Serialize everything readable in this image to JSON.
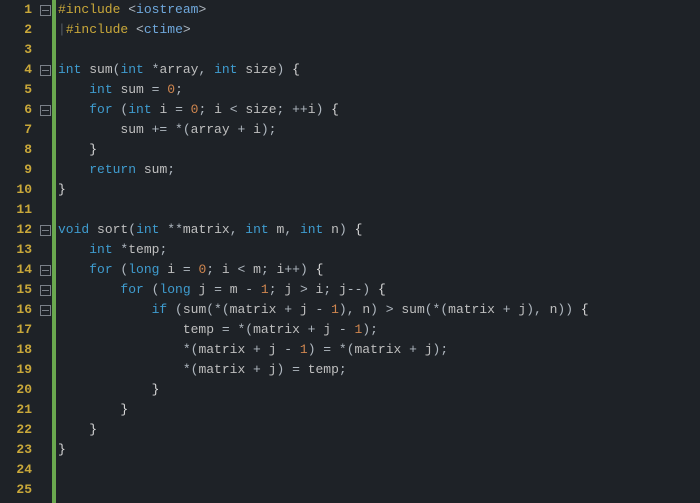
{
  "language": "cpp",
  "tab_size": 4,
  "lines": [
    {
      "n": 1,
      "fold": true,
      "tokens": [
        [
          "pp",
          "#include"
        ],
        [
          "op",
          " "
        ],
        [
          "op",
          "<"
        ],
        [
          "hdr",
          "iostream"
        ],
        [
          "op",
          ">"
        ]
      ]
    },
    {
      "n": 2,
      "fold": false,
      "bar_indent": 1,
      "tokens": [
        [
          "pp",
          "#include"
        ],
        [
          "op",
          " "
        ],
        [
          "op",
          "<"
        ],
        [
          "hdr",
          "ctime"
        ],
        [
          "op",
          ">"
        ]
      ]
    },
    {
      "n": 3,
      "fold": false,
      "tokens": []
    },
    {
      "n": 4,
      "fold": true,
      "tokens": [
        [
          "kw",
          "int"
        ],
        [
          "op",
          " "
        ],
        [
          "fn",
          "sum"
        ],
        [
          "op",
          "("
        ],
        [
          "kw",
          "int"
        ],
        [
          "op",
          " *"
        ],
        [
          "id",
          "array"
        ],
        [
          "op",
          ", "
        ],
        [
          "kw",
          "int"
        ],
        [
          "op",
          " "
        ],
        [
          "id",
          "size"
        ],
        [
          "op",
          ") "
        ],
        [
          "brace",
          "{"
        ]
      ]
    },
    {
      "n": 5,
      "fold": false,
      "tokens": [
        [
          "op",
          "    "
        ],
        [
          "kw",
          "int"
        ],
        [
          "op",
          " "
        ],
        [
          "id",
          "sum"
        ],
        [
          "op",
          " = "
        ],
        [
          "num",
          "0"
        ],
        [
          "op",
          ";"
        ]
      ]
    },
    {
      "n": 6,
      "fold": true,
      "tokens": [
        [
          "op",
          "    "
        ],
        [
          "ctl",
          "for"
        ],
        [
          "op",
          " ("
        ],
        [
          "kw",
          "int"
        ],
        [
          "op",
          " "
        ],
        [
          "id",
          "i"
        ],
        [
          "op",
          " = "
        ],
        [
          "num",
          "0"
        ],
        [
          "op",
          "; "
        ],
        [
          "id",
          "i"
        ],
        [
          "op",
          " < "
        ],
        [
          "id",
          "size"
        ],
        [
          "op",
          "; ++"
        ],
        [
          "id",
          "i"
        ],
        [
          "op",
          ") "
        ],
        [
          "brace",
          "{"
        ]
      ]
    },
    {
      "n": 7,
      "fold": false,
      "tokens": [
        [
          "op",
          "        "
        ],
        [
          "id",
          "sum"
        ],
        [
          "op",
          " += *("
        ],
        [
          "id",
          "array"
        ],
        [
          "op",
          " + "
        ],
        [
          "id",
          "i"
        ],
        [
          "op",
          ");"
        ]
      ]
    },
    {
      "n": 8,
      "fold": false,
      "tokens": [
        [
          "op",
          "    "
        ],
        [
          "brace",
          "}"
        ]
      ]
    },
    {
      "n": 9,
      "fold": false,
      "tokens": [
        [
          "op",
          "    "
        ],
        [
          "ctl",
          "return"
        ],
        [
          "op",
          " "
        ],
        [
          "id",
          "sum"
        ],
        [
          "op",
          ";"
        ]
      ]
    },
    {
      "n": 10,
      "fold": false,
      "tokens": [
        [
          "brace",
          "}"
        ]
      ]
    },
    {
      "n": 11,
      "fold": false,
      "tokens": []
    },
    {
      "n": 12,
      "fold": true,
      "tokens": [
        [
          "kw",
          "void"
        ],
        [
          "op",
          " "
        ],
        [
          "fn",
          "sort"
        ],
        [
          "op",
          "("
        ],
        [
          "kw",
          "int"
        ],
        [
          "op",
          " **"
        ],
        [
          "id",
          "matrix"
        ],
        [
          "op",
          ", "
        ],
        [
          "kw",
          "int"
        ],
        [
          "op",
          " "
        ],
        [
          "id",
          "m"
        ],
        [
          "op",
          ", "
        ],
        [
          "kw",
          "int"
        ],
        [
          "op",
          " "
        ],
        [
          "id",
          "n"
        ],
        [
          "op",
          ") "
        ],
        [
          "brace",
          "{"
        ]
      ]
    },
    {
      "n": 13,
      "fold": false,
      "tokens": [
        [
          "op",
          "    "
        ],
        [
          "kw",
          "int"
        ],
        [
          "op",
          " *"
        ],
        [
          "id",
          "temp"
        ],
        [
          "op",
          ";"
        ]
      ]
    },
    {
      "n": 14,
      "fold": true,
      "tokens": [
        [
          "op",
          "    "
        ],
        [
          "ctl",
          "for"
        ],
        [
          "op",
          " ("
        ],
        [
          "kw",
          "long"
        ],
        [
          "op",
          " "
        ],
        [
          "id",
          "i"
        ],
        [
          "op",
          " = "
        ],
        [
          "num",
          "0"
        ],
        [
          "op",
          "; "
        ],
        [
          "id",
          "i"
        ],
        [
          "op",
          " < "
        ],
        [
          "id",
          "m"
        ],
        [
          "op",
          "; "
        ],
        [
          "id",
          "i"
        ],
        [
          "op",
          "++) "
        ],
        [
          "brace",
          "{"
        ]
      ]
    },
    {
      "n": 15,
      "fold": true,
      "tokens": [
        [
          "op",
          "        "
        ],
        [
          "ctl",
          "for"
        ],
        [
          "op",
          " ("
        ],
        [
          "kw",
          "long"
        ],
        [
          "op",
          " "
        ],
        [
          "id",
          "j"
        ],
        [
          "op",
          " = "
        ],
        [
          "id",
          "m"
        ],
        [
          "op",
          " - "
        ],
        [
          "num",
          "1"
        ],
        [
          "op",
          "; "
        ],
        [
          "id",
          "j"
        ],
        [
          "op",
          " > "
        ],
        [
          "id",
          "i"
        ],
        [
          "op",
          "; "
        ],
        [
          "id",
          "j"
        ],
        [
          "op",
          "--) "
        ],
        [
          "brace",
          "{"
        ]
      ]
    },
    {
      "n": 16,
      "fold": true,
      "tokens": [
        [
          "op",
          "            "
        ],
        [
          "ctl",
          "if"
        ],
        [
          "op",
          " ("
        ],
        [
          "fn",
          "sum"
        ],
        [
          "op",
          "(*("
        ],
        [
          "id",
          "matrix"
        ],
        [
          "op",
          " + "
        ],
        [
          "id",
          "j"
        ],
        [
          "op",
          " - "
        ],
        [
          "num",
          "1"
        ],
        [
          "op",
          "), "
        ],
        [
          "id",
          "n"
        ],
        [
          "op",
          ") > "
        ],
        [
          "fn",
          "sum"
        ],
        [
          "op",
          "(*("
        ],
        [
          "id",
          "matrix"
        ],
        [
          "op",
          " + "
        ],
        [
          "id",
          "j"
        ],
        [
          "op",
          "), "
        ],
        [
          "id",
          "n"
        ],
        [
          "op",
          ")) "
        ],
        [
          "brace",
          "{"
        ]
      ]
    },
    {
      "n": 17,
      "fold": false,
      "tokens": [
        [
          "op",
          "                "
        ],
        [
          "id",
          "temp"
        ],
        [
          "op",
          " = *("
        ],
        [
          "id",
          "matrix"
        ],
        [
          "op",
          " + "
        ],
        [
          "id",
          "j"
        ],
        [
          "op",
          " - "
        ],
        [
          "num",
          "1"
        ],
        [
          "op",
          ");"
        ]
      ]
    },
    {
      "n": 18,
      "fold": false,
      "tokens": [
        [
          "op",
          "                *("
        ],
        [
          "id",
          "matrix"
        ],
        [
          "op",
          " + "
        ],
        [
          "id",
          "j"
        ],
        [
          "op",
          " - "
        ],
        [
          "num",
          "1"
        ],
        [
          "op",
          ") = *("
        ],
        [
          "id",
          "matrix"
        ],
        [
          "op",
          " + "
        ],
        [
          "id",
          "j"
        ],
        [
          "op",
          ");"
        ]
      ]
    },
    {
      "n": 19,
      "fold": false,
      "tokens": [
        [
          "op",
          "                *("
        ],
        [
          "id",
          "matrix"
        ],
        [
          "op",
          " + "
        ],
        [
          "id",
          "j"
        ],
        [
          "op",
          ") = "
        ],
        [
          "id",
          "temp"
        ],
        [
          "op",
          ";"
        ]
      ]
    },
    {
      "n": 20,
      "fold": false,
      "tokens": [
        [
          "op",
          "            "
        ],
        [
          "brace",
          "}"
        ]
      ]
    },
    {
      "n": 21,
      "fold": false,
      "tokens": [
        [
          "op",
          "        "
        ],
        [
          "brace",
          "}"
        ]
      ]
    },
    {
      "n": 22,
      "fold": false,
      "tokens": [
        [
          "op",
          "    "
        ],
        [
          "brace",
          "}"
        ]
      ]
    },
    {
      "n": 23,
      "fold": false,
      "tokens": [
        [
          "brace",
          "}"
        ]
      ]
    },
    {
      "n": 24,
      "fold": false,
      "tokens": []
    },
    {
      "n": 25,
      "fold": false,
      "tokens": []
    }
  ]
}
